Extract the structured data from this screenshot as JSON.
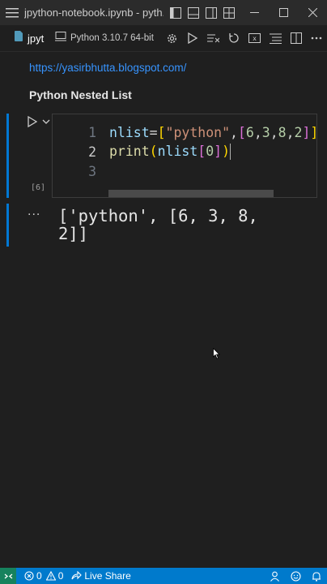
{
  "window": {
    "title": "jpython-notebook.ipynb - pyth..."
  },
  "toolbar": {
    "tab_label": "jpyt",
    "kernel_label": "Python 3.10.7 64-bit"
  },
  "notebook": {
    "link_text": "https://yasirbhutta.blogspot.com/",
    "heading": "Python Nested List",
    "cell": {
      "execution_count": "[6]",
      "line_numbers": [
        "1",
        "2",
        "3"
      ],
      "line1_tokens": [
        "nlist",
        "=",
        "[",
        "\"python\"",
        ",",
        "[",
        "6",
        ",",
        "3",
        ",",
        "8",
        ",",
        "2",
        "]",
        "]"
      ],
      "line2_tokens": [
        "print",
        "(",
        "nlist",
        "[",
        "0",
        "]",
        ")"
      ]
    },
    "output": {
      "dots": "...",
      "text": "['python', [6, 3, 8, 2]]"
    }
  },
  "statusbar": {
    "errors": "0",
    "warnings": "0",
    "live_share": "Live Share"
  }
}
